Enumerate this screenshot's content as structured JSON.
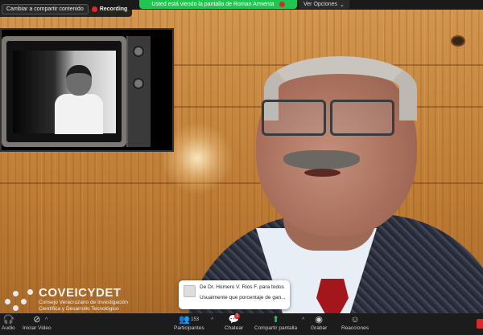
{
  "top": {
    "share_button": "Cambiar a compartir contenido",
    "recording_label": "Recording",
    "banner_text": "Usted está viendo la pantalla de Roman Armenta",
    "view_options": "Ver Opciones"
  },
  "logo": {
    "title": "COVEICYDET",
    "subtitle_line1": "Consejo Veracruzano de Investigación",
    "subtitle_line2": "Científica y Desarrollo Tecnológico"
  },
  "chat": {
    "from": "De Dr. Homero V. Rios F. para todos",
    "message": "Usualmente que porcentaje de gan..."
  },
  "toolbar": {
    "audio": "Audio",
    "video": "Iniciar Video",
    "participants": "Participantes",
    "participant_count": "153",
    "chat": "Chatear",
    "chat_badge": "1",
    "share": "Compartir pantalla",
    "record": "Grabar",
    "reactions": "Reacciones"
  },
  "colors": {
    "banner": "#23c552",
    "record": "#e02828",
    "share_accent": "#22c45b"
  }
}
